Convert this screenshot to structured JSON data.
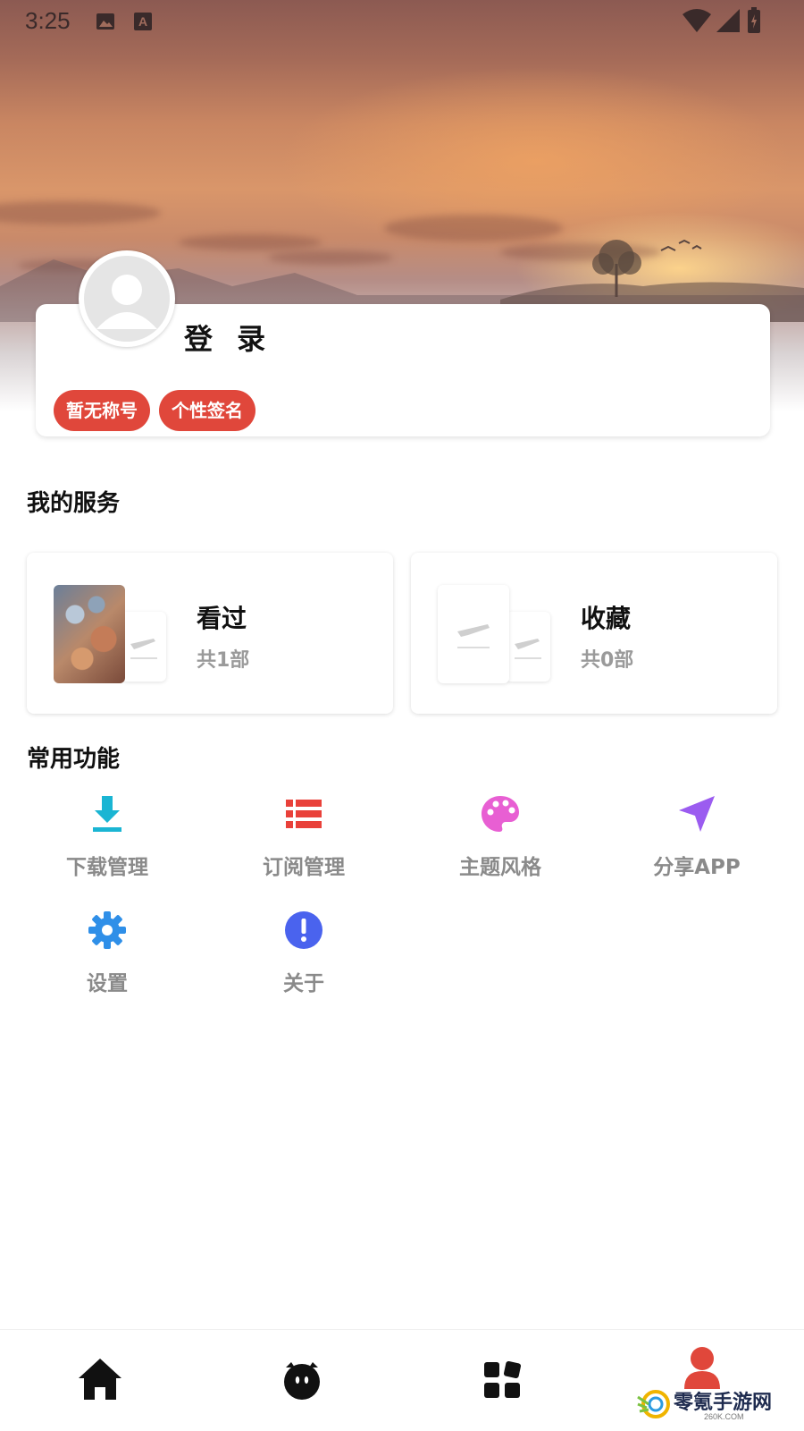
{
  "status_bar": {
    "time": "3:25",
    "icons": [
      "image-icon",
      "a-font-icon",
      "wifi-icon",
      "signal-icon",
      "battery-icon"
    ]
  },
  "profile": {
    "login_label": "登 录",
    "tags": [
      "暂无称号",
      "个性签名"
    ],
    "accent_color": "#e0473b"
  },
  "services": {
    "title": "我的服务",
    "cards": [
      {
        "title": "看过",
        "count": "共1部"
      },
      {
        "title": "收藏",
        "count": "共0部"
      }
    ]
  },
  "functions": {
    "title": "常用功能",
    "items": [
      {
        "label": "下载管理",
        "icon": "download-icon",
        "color": "#1ab5d3"
      },
      {
        "label": "订阅管理",
        "icon": "list-icon",
        "color": "#e9413a"
      },
      {
        "label": "主题风格",
        "icon": "palette-icon",
        "color": "#e85fd3"
      },
      {
        "label": "分享APP",
        "icon": "send-icon",
        "color": "#9b5cf0"
      },
      {
        "label": "设置",
        "icon": "gear-icon",
        "color": "#2f8fe8"
      },
      {
        "label": "关于",
        "icon": "info-icon",
        "color": "#4a63ee"
      }
    ]
  },
  "bottom_nav": {
    "items": [
      "home-icon",
      "face-icon",
      "grid-icon",
      "user-icon"
    ],
    "active_color": "#e0473b"
  },
  "watermark": {
    "text": "零氪手游网",
    "sub": "260K.COM"
  }
}
